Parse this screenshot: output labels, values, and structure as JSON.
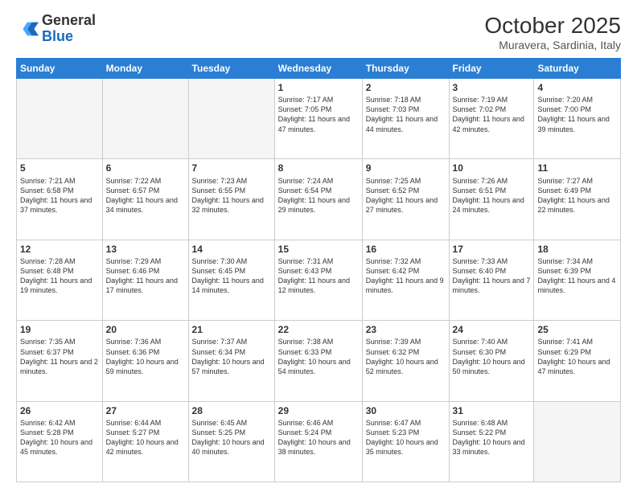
{
  "logo": {
    "general": "General",
    "blue": "Blue"
  },
  "header": {
    "month": "October 2025",
    "location": "Muravera, Sardinia, Italy"
  },
  "days_of_week": [
    "Sunday",
    "Monday",
    "Tuesday",
    "Wednesday",
    "Thursday",
    "Friday",
    "Saturday"
  ],
  "weeks": [
    [
      {
        "day": "",
        "info": ""
      },
      {
        "day": "",
        "info": ""
      },
      {
        "day": "",
        "info": ""
      },
      {
        "day": "1",
        "info": "Sunrise: 7:17 AM\nSunset: 7:05 PM\nDaylight: 11 hours and 47 minutes."
      },
      {
        "day": "2",
        "info": "Sunrise: 7:18 AM\nSunset: 7:03 PM\nDaylight: 11 hours and 44 minutes."
      },
      {
        "day": "3",
        "info": "Sunrise: 7:19 AM\nSunset: 7:02 PM\nDaylight: 11 hours and 42 minutes."
      },
      {
        "day": "4",
        "info": "Sunrise: 7:20 AM\nSunset: 7:00 PM\nDaylight: 11 hours and 39 minutes."
      }
    ],
    [
      {
        "day": "5",
        "info": "Sunrise: 7:21 AM\nSunset: 6:58 PM\nDaylight: 11 hours and 37 minutes."
      },
      {
        "day": "6",
        "info": "Sunrise: 7:22 AM\nSunset: 6:57 PM\nDaylight: 11 hours and 34 minutes."
      },
      {
        "day": "7",
        "info": "Sunrise: 7:23 AM\nSunset: 6:55 PM\nDaylight: 11 hours and 32 minutes."
      },
      {
        "day": "8",
        "info": "Sunrise: 7:24 AM\nSunset: 6:54 PM\nDaylight: 11 hours and 29 minutes."
      },
      {
        "day": "9",
        "info": "Sunrise: 7:25 AM\nSunset: 6:52 PM\nDaylight: 11 hours and 27 minutes."
      },
      {
        "day": "10",
        "info": "Sunrise: 7:26 AM\nSunset: 6:51 PM\nDaylight: 11 hours and 24 minutes."
      },
      {
        "day": "11",
        "info": "Sunrise: 7:27 AM\nSunset: 6:49 PM\nDaylight: 11 hours and 22 minutes."
      }
    ],
    [
      {
        "day": "12",
        "info": "Sunrise: 7:28 AM\nSunset: 6:48 PM\nDaylight: 11 hours and 19 minutes."
      },
      {
        "day": "13",
        "info": "Sunrise: 7:29 AM\nSunset: 6:46 PM\nDaylight: 11 hours and 17 minutes."
      },
      {
        "day": "14",
        "info": "Sunrise: 7:30 AM\nSunset: 6:45 PM\nDaylight: 11 hours and 14 minutes."
      },
      {
        "day": "15",
        "info": "Sunrise: 7:31 AM\nSunset: 6:43 PM\nDaylight: 11 hours and 12 minutes."
      },
      {
        "day": "16",
        "info": "Sunrise: 7:32 AM\nSunset: 6:42 PM\nDaylight: 11 hours and 9 minutes."
      },
      {
        "day": "17",
        "info": "Sunrise: 7:33 AM\nSunset: 6:40 PM\nDaylight: 11 hours and 7 minutes."
      },
      {
        "day": "18",
        "info": "Sunrise: 7:34 AM\nSunset: 6:39 PM\nDaylight: 11 hours and 4 minutes."
      }
    ],
    [
      {
        "day": "19",
        "info": "Sunrise: 7:35 AM\nSunset: 6:37 PM\nDaylight: 11 hours and 2 minutes."
      },
      {
        "day": "20",
        "info": "Sunrise: 7:36 AM\nSunset: 6:36 PM\nDaylight: 10 hours and 59 minutes."
      },
      {
        "day": "21",
        "info": "Sunrise: 7:37 AM\nSunset: 6:34 PM\nDaylight: 10 hours and 57 minutes."
      },
      {
        "day": "22",
        "info": "Sunrise: 7:38 AM\nSunset: 6:33 PM\nDaylight: 10 hours and 54 minutes."
      },
      {
        "day": "23",
        "info": "Sunrise: 7:39 AM\nSunset: 6:32 PM\nDaylight: 10 hours and 52 minutes."
      },
      {
        "day": "24",
        "info": "Sunrise: 7:40 AM\nSunset: 6:30 PM\nDaylight: 10 hours and 50 minutes."
      },
      {
        "day": "25",
        "info": "Sunrise: 7:41 AM\nSunset: 6:29 PM\nDaylight: 10 hours and 47 minutes."
      }
    ],
    [
      {
        "day": "26",
        "info": "Sunrise: 6:42 AM\nSunset: 5:28 PM\nDaylight: 10 hours and 45 minutes."
      },
      {
        "day": "27",
        "info": "Sunrise: 6:44 AM\nSunset: 5:27 PM\nDaylight: 10 hours and 42 minutes."
      },
      {
        "day": "28",
        "info": "Sunrise: 6:45 AM\nSunset: 5:25 PM\nDaylight: 10 hours and 40 minutes."
      },
      {
        "day": "29",
        "info": "Sunrise: 6:46 AM\nSunset: 5:24 PM\nDaylight: 10 hours and 38 minutes."
      },
      {
        "day": "30",
        "info": "Sunrise: 6:47 AM\nSunset: 5:23 PM\nDaylight: 10 hours and 35 minutes."
      },
      {
        "day": "31",
        "info": "Sunrise: 6:48 AM\nSunset: 5:22 PM\nDaylight: 10 hours and 33 minutes."
      },
      {
        "day": "",
        "info": ""
      }
    ]
  ]
}
